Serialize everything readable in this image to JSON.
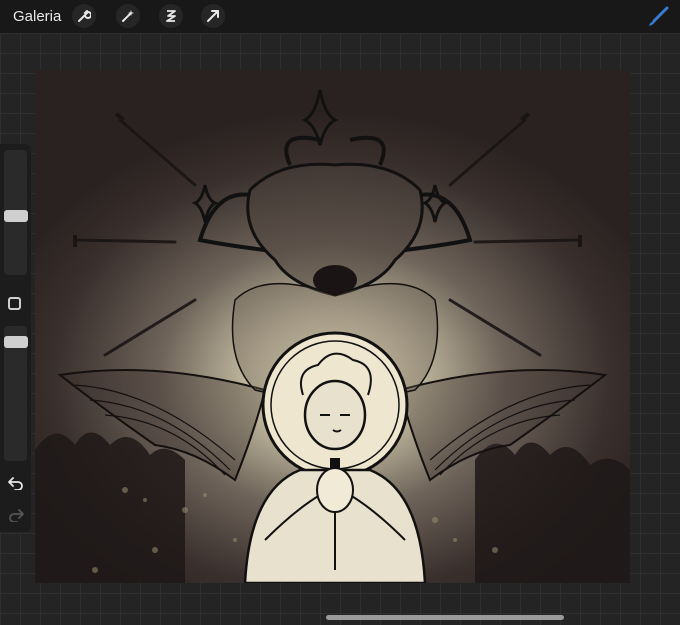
{
  "topbar": {
    "gallery_label": "Galeria",
    "tools": [
      {
        "name": "wrench-icon"
      },
      {
        "name": "magic-wand-icon"
      },
      {
        "name": "selection-icon"
      },
      {
        "name": "move-arrow-icon"
      }
    ],
    "active_tool_icon": "brush-icon",
    "accent_color": "#3a7bd5"
  },
  "sidebar": {
    "brush_size_level": 0.5,
    "opacity_level": 0.6,
    "controls": [
      "brush-size-slider",
      "modify-button",
      "opacity-slider",
      "undo-icon",
      "redo-icon"
    ]
  },
  "canvas": {
    "description_color_background": "#2f2624",
    "glow_color": "#fff8dd"
  }
}
